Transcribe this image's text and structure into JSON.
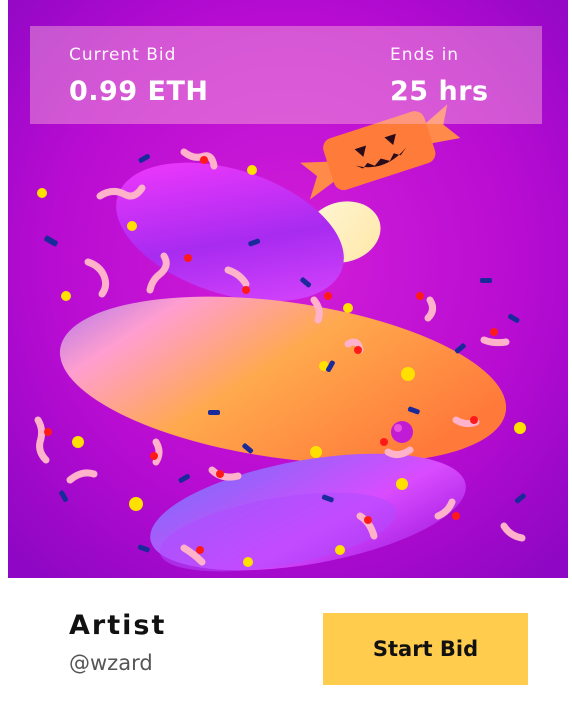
{
  "bid": {
    "current_label": "Current Bid",
    "current_value": "0.99 ETH",
    "ends_label": "Ends in",
    "ends_value": "25 hrs"
  },
  "artist": {
    "label": "Artist",
    "handle": "@wzard"
  },
  "actions": {
    "start_bid_label": "Start Bid"
  },
  "colors": {
    "background_purple": "#b100d6",
    "button_yellow": "#ffcc4d",
    "bid_bar_tint": "#ffbedc"
  },
  "artwork": {
    "icons": [
      "pumpkin-candy-icon",
      "sprinkles",
      "gummy-worms"
    ]
  }
}
